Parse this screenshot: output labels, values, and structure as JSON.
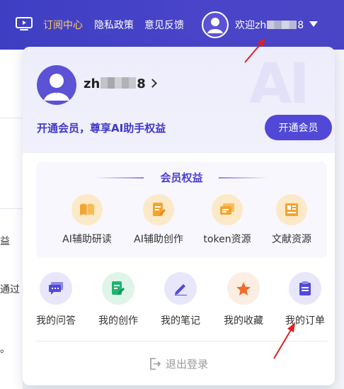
{
  "topbar": {
    "nav": [
      "订阅中心",
      "隐私政策",
      "意见反馈"
    ],
    "welcome_prefix": "欢迎zh",
    "welcome_suffix": "8"
  },
  "background": {
    "left_texts": [
      "益",
      "通过",
      "。"
    ]
  },
  "panel": {
    "user_prefix": "zh",
    "user_suffix": "8",
    "promo_text": "开通会员，尊享AI助手权益",
    "open_button": "开通会员",
    "watermark": "AI",
    "benefits_title": "会员权益",
    "benefits": [
      {
        "label": "AI辅助研读",
        "icon": "book-icon"
      },
      {
        "label": "AI辅助创作",
        "icon": "document-edit-icon"
      },
      {
        "label": "token资源",
        "icon": "token-cards-icon"
      },
      {
        "label": "文献资源",
        "icon": "literature-icon"
      }
    ],
    "quick_links": [
      {
        "label": "我的问答",
        "icon": "chat-icon",
        "bg": "#e8e6fb"
      },
      {
        "label": "我的创作",
        "icon": "edit-document-icon",
        "bg": "#dff5ea"
      },
      {
        "label": "我的笔记",
        "icon": "pen-icon",
        "bg": "#e8e6fb"
      },
      {
        "label": "我的收藏",
        "icon": "star-icon",
        "bg": "#fdeee4"
      },
      {
        "label": "我的订单",
        "icon": "clipboard-icon",
        "bg": "#e8e6fb"
      }
    ],
    "logout": "退出登录"
  },
  "colors": {
    "brand": "#4a44c9",
    "accent_yellow": "#ffd15c",
    "button": "#5148d8",
    "annotation_arrow": "#e02020"
  }
}
